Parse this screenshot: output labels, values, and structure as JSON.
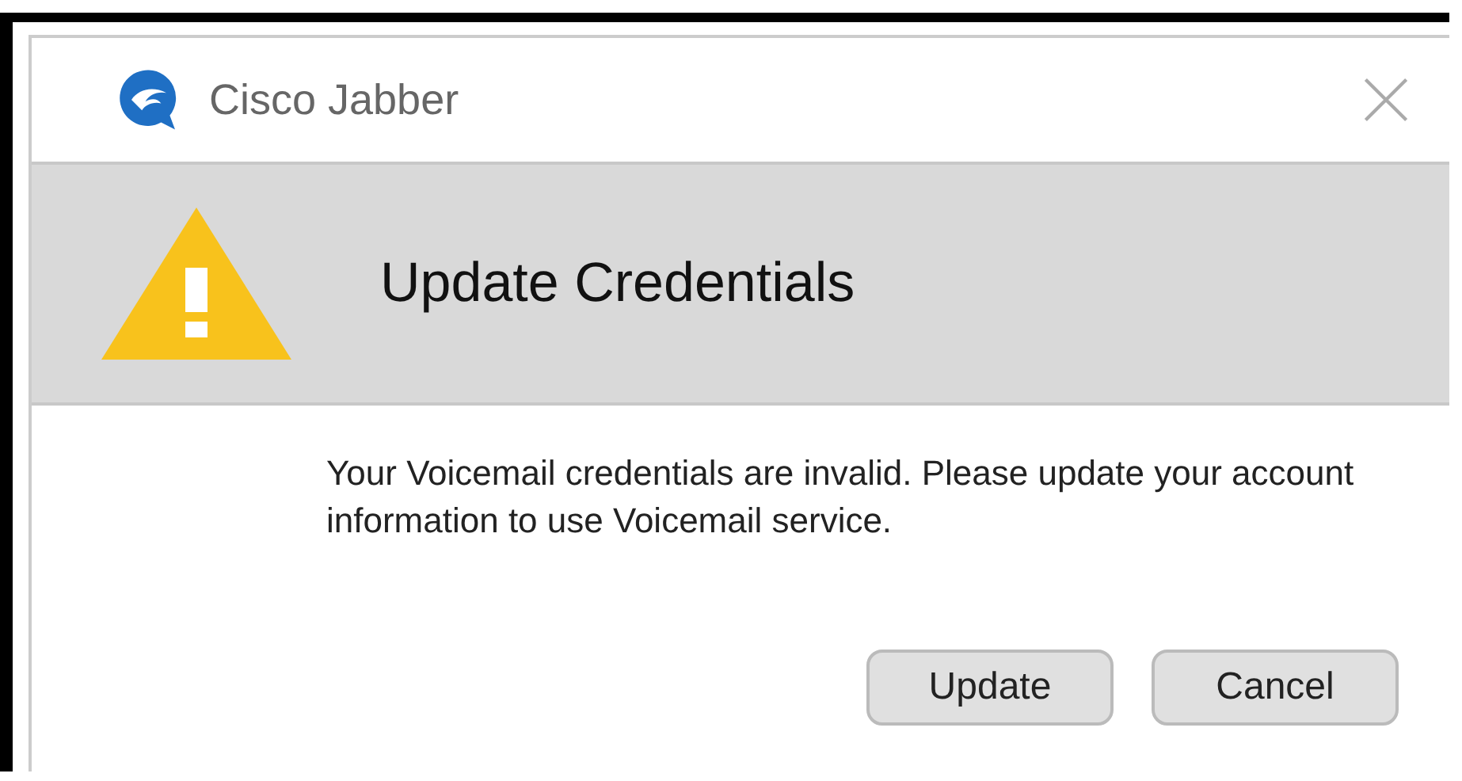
{
  "window": {
    "title": "Cisco Jabber"
  },
  "banner": {
    "title": "Update Credentials"
  },
  "message": "Your Voicemail credentials are invalid. Please update your account information to use Voicemail service.",
  "buttons": [
    {
      "label": "Update"
    },
    {
      "label": "Cancel"
    }
  ]
}
